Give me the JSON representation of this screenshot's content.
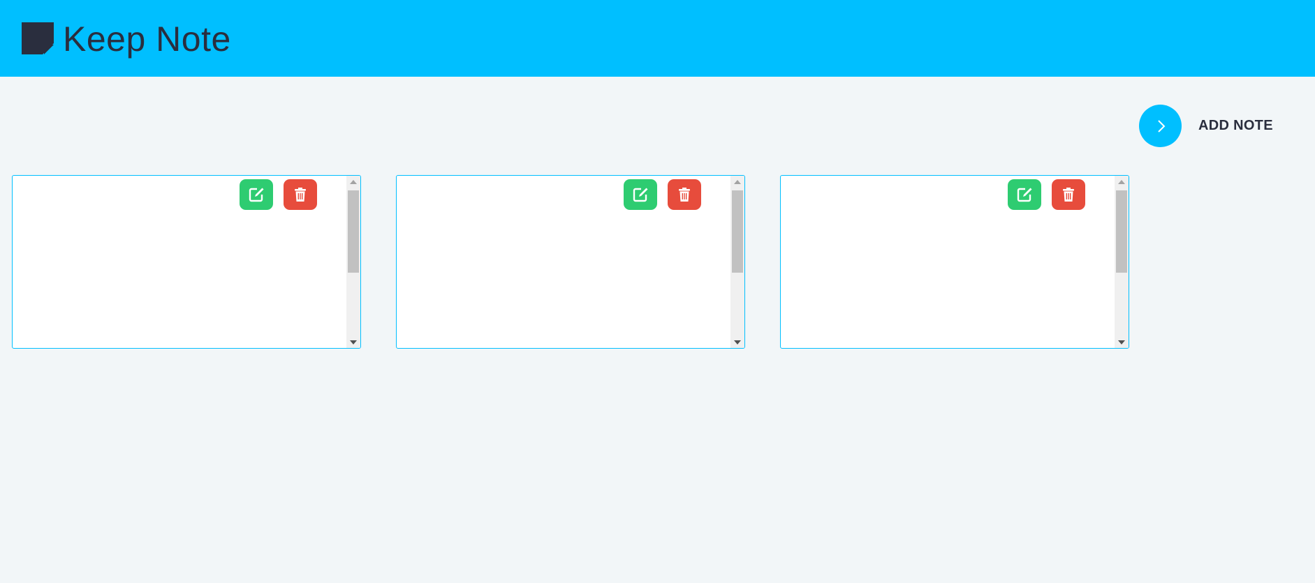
{
  "header": {
    "title": "Keep Note",
    "logo_icon": "sticky-note-icon",
    "background_color": "#00bfff"
  },
  "add_note": {
    "label": "ADD NOTE",
    "icon": "chevron-right-icon"
  },
  "notes": [
    {
      "content": "",
      "edit_icon": "edit-icon",
      "delete_icon": "trash-icon"
    },
    {
      "content": "",
      "edit_icon": "edit-icon",
      "delete_icon": "trash-icon"
    },
    {
      "content": "",
      "edit_icon": "edit-icon",
      "delete_icon": "trash-icon"
    }
  ],
  "colors": {
    "accent": "#00bfff",
    "edit": "#2ecc71",
    "delete": "#e74c3c",
    "text": "#2a2e3e",
    "page_background": "#f2f6f8"
  }
}
